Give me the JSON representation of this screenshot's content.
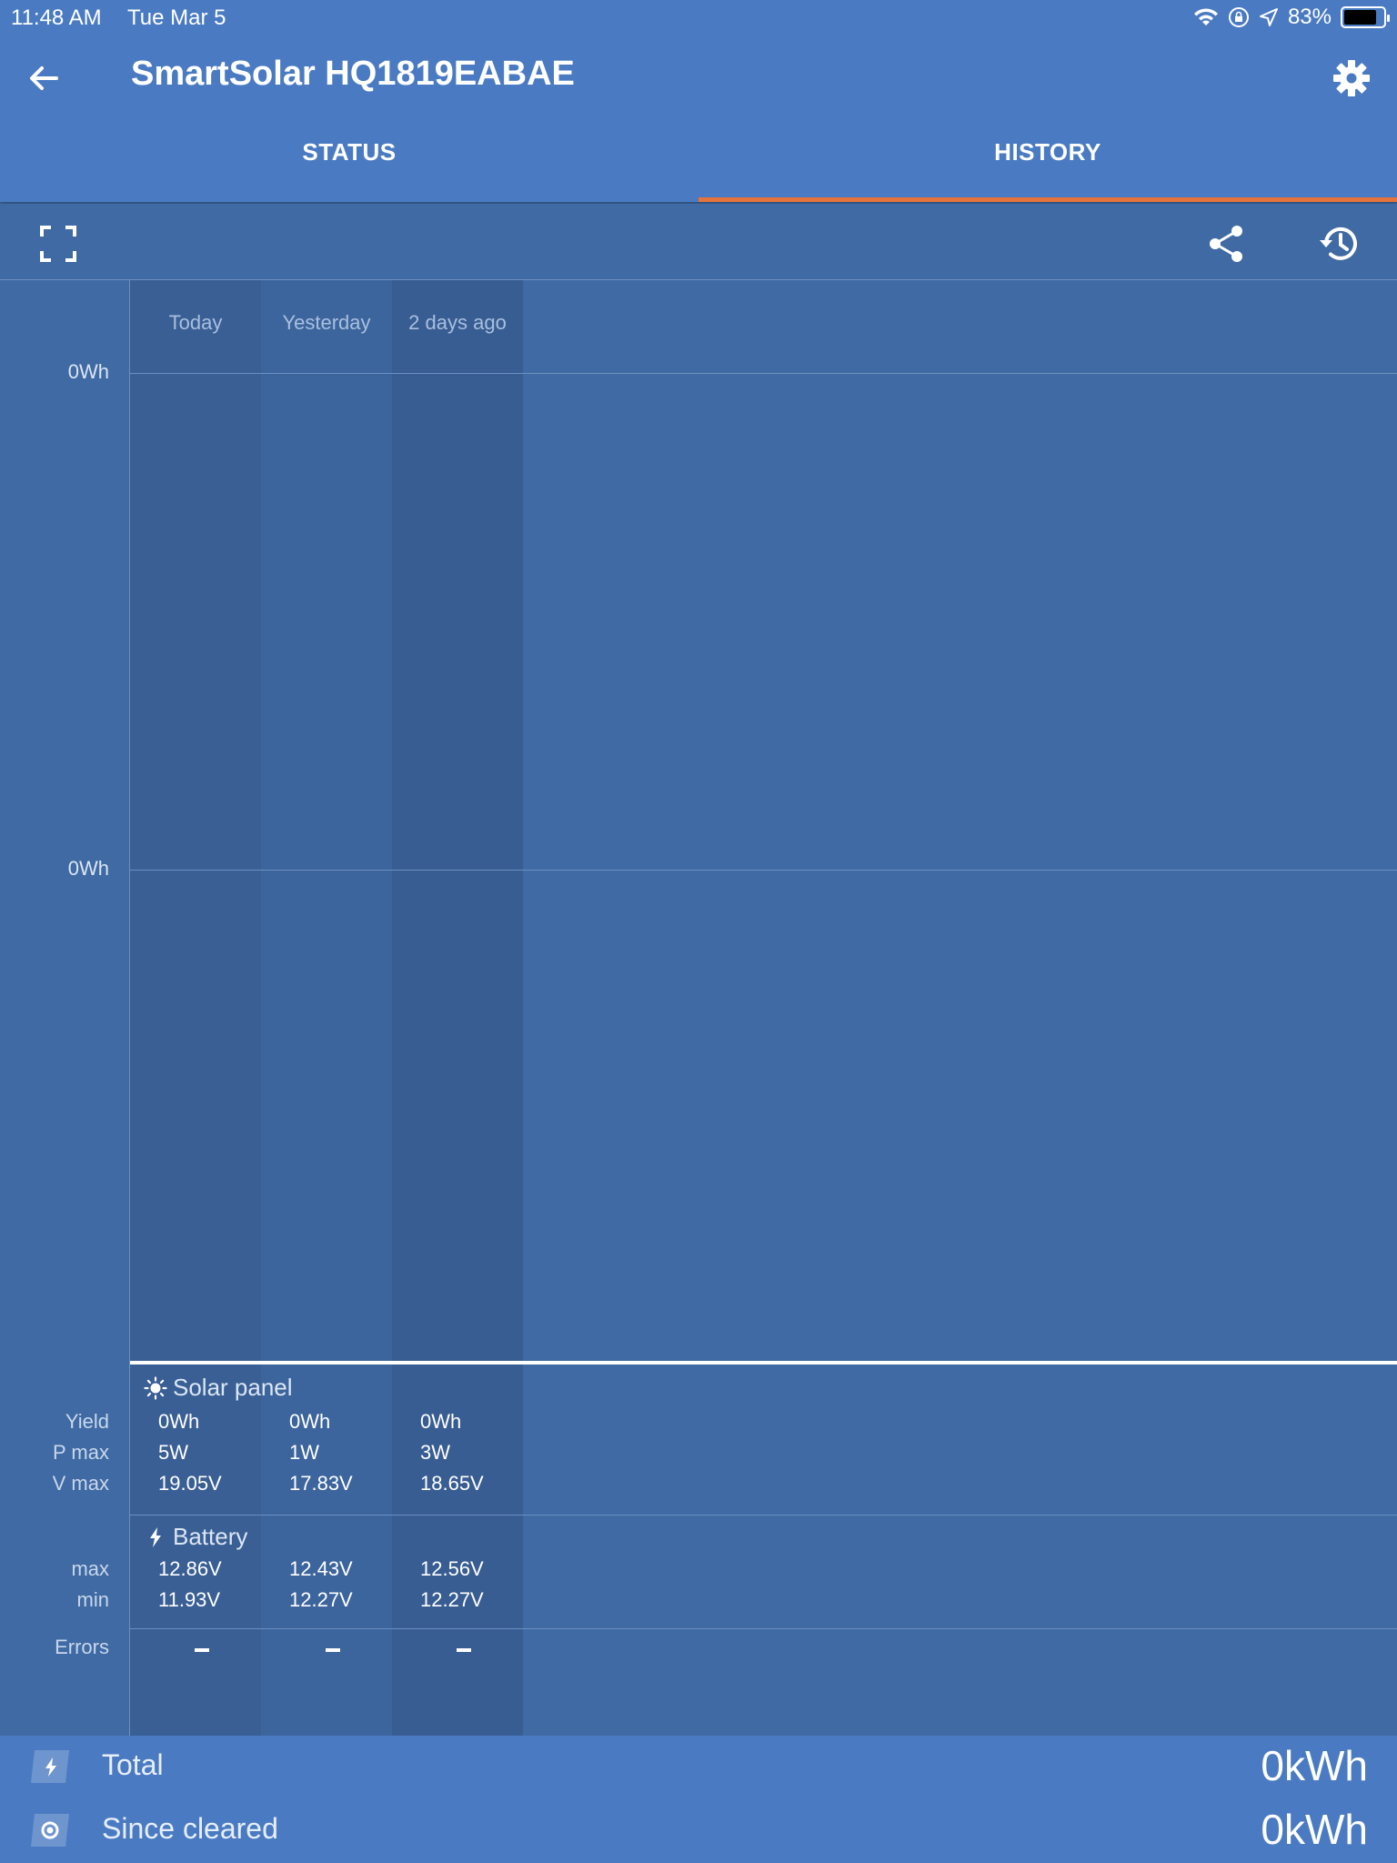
{
  "statusbar": {
    "time": "11:48 AM",
    "date": "Tue Mar 5",
    "battery": "83%"
  },
  "header": {
    "title": "SmartSolar HQ1819EABAE"
  },
  "tabs": [
    {
      "label": "STATUS"
    },
    {
      "label": "HISTORY"
    }
  ],
  "chart": {
    "columns": [
      "Today",
      "Yesterday",
      "2 days ago"
    ],
    "ylabels": [
      "0Wh",
      "0Wh"
    ]
  },
  "solar": {
    "title": "Solar panel",
    "labels": {
      "yield": "Yield",
      "pmax": "P max",
      "vmax": "V max"
    },
    "yield": [
      "0Wh",
      "0Wh",
      "0Wh"
    ],
    "pmax": [
      "5W",
      "1W",
      "3W"
    ],
    "vmax": [
      "19.05V",
      "17.83V",
      "18.65V"
    ]
  },
  "battery": {
    "title": "Battery",
    "labels": {
      "max": "max",
      "min": "min"
    },
    "max": [
      "12.86V",
      "12.43V",
      "12.56V"
    ],
    "min": [
      "11.93V",
      "12.27V",
      "12.27V"
    ]
  },
  "errors": {
    "label": "Errors"
  },
  "footer": {
    "total_label": "Total",
    "total_value": "0kWh",
    "cleared_label": "Since cleared",
    "cleared_value": "0kWh"
  },
  "icons": {
    "back": "arrow-back-icon",
    "settings": "gear-icon",
    "fullscreen": "fullscreen-icon",
    "share": "share-icon",
    "history": "history-icon",
    "sun": "sun-icon",
    "bolt": "bolt-icon"
  }
}
